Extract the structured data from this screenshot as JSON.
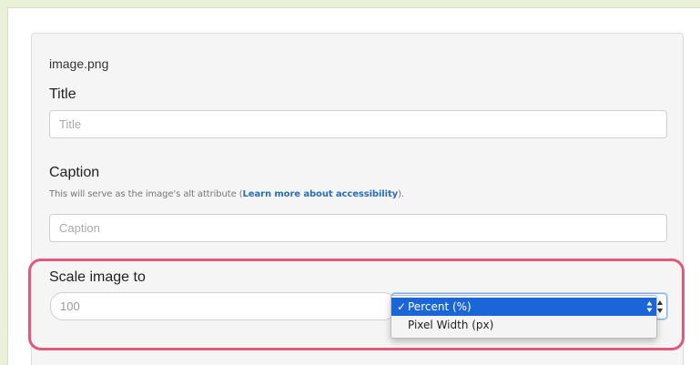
{
  "file_name": "image.png",
  "title_field": {
    "label": "Title",
    "placeholder": "Title",
    "value": ""
  },
  "caption_field": {
    "label": "Caption",
    "helper_prefix": "This will serve as the image's alt attribute (",
    "helper_link": "Learn more about accessibility",
    "helper_suffix": ").",
    "placeholder": "Caption",
    "value": ""
  },
  "scale": {
    "label": "Scale image to",
    "value_text": "100",
    "selected_unit": "Percent (%)",
    "options": [
      {
        "label": "Percent (%)",
        "check": "✓",
        "selected": true
      },
      {
        "label": "Pixel Width (px)",
        "check": "",
        "selected": false
      }
    ]
  },
  "colors": {
    "highlight_border": "#e05a7b",
    "link": "#2a6ebb",
    "selected_option_bg": "#1a66d9"
  }
}
